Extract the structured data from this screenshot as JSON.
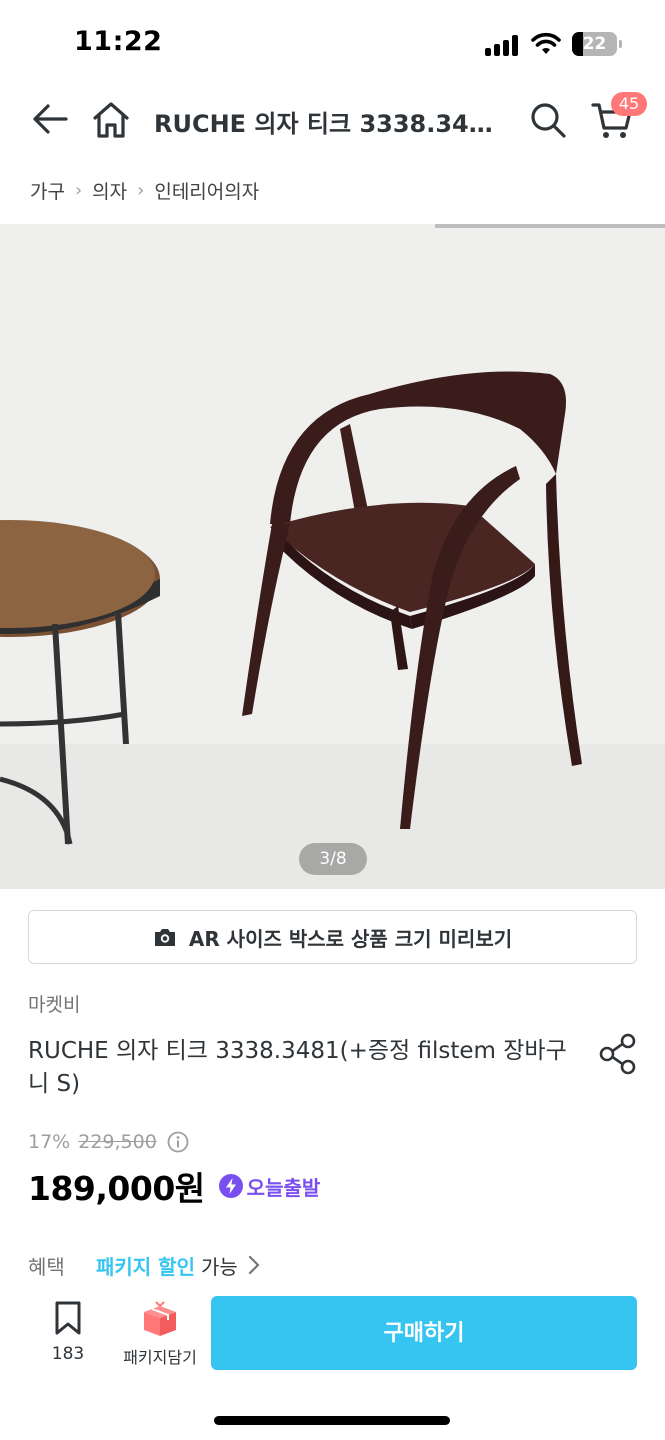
{
  "status_bar": {
    "time": "11:22",
    "battery_level": "22",
    "icons": [
      "signal-icon",
      "wifi-icon",
      "battery-icon"
    ]
  },
  "header": {
    "title": "RUCHE 의자 티크 3338.348...",
    "cart_count": "45",
    "icons": [
      "back-icon",
      "home-icon",
      "search-icon",
      "cart-icon"
    ]
  },
  "breadcrumb": [
    "가구",
    "의자",
    "인테리어의자"
  ],
  "gallery": {
    "counter": "3/8",
    "current_index": 3,
    "total": 8
  },
  "ar_button": {
    "label": "AR 사이즈 박스로 상품 크기 미리보기",
    "icon": "camera-icon"
  },
  "product": {
    "seller": "마켓비",
    "title": "RUCHE 의자 티크 3338.3481(+증정 filstem 장바구니 S)",
    "discount_rate": "17%",
    "original_price": "229,500",
    "price": "189,000원",
    "delivery_badge": "오늘출발"
  },
  "benefit": {
    "label": "혜택",
    "link": "패키지 할인",
    "suffix": "가능"
  },
  "bottom_bar": {
    "bookmark_count": "183",
    "package_label": "패키지담기",
    "buy_label": "구매하기"
  },
  "colors": {
    "accent": "#35c5f0",
    "badge": "#ff7777",
    "today_purple": "#7a4ff0",
    "text": "#2f3438"
  }
}
